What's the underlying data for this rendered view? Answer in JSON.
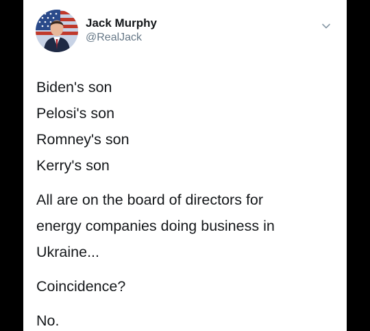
{
  "tweet": {
    "author_name": "Jack Murphy",
    "author_handle": "@RealJack",
    "avatar_icon": "profile-photo-flag",
    "menu_icon": "chevron-down-icon",
    "lines": [
      "Biden's son",
      "Pelosi's son",
      "Romney's son",
      "Kerry's son"
    ],
    "paragraph_lines": [
      "All are on the board of directors for",
      "energy companies doing business in",
      "Ukraine..."
    ],
    "question": "Coincidence?",
    "answer": "No."
  },
  "colors": {
    "text": "#14171a",
    "secondary_text": "#657786",
    "border_bars": "#000000",
    "background": "#ffffff"
  }
}
